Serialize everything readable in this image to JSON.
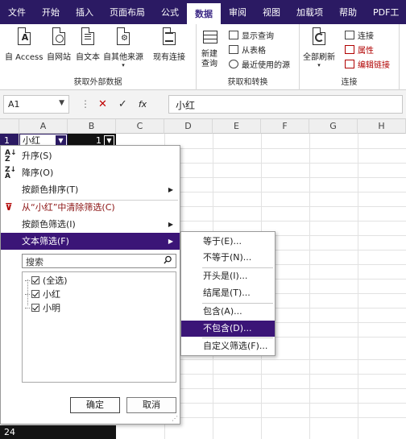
{
  "menu": {
    "tabs": [
      "文件",
      "开始",
      "插入",
      "页面布局",
      "公式",
      "数据",
      "审阅",
      "视图",
      "加载项",
      "帮助",
      "PDF工"
    ],
    "active_tab": "数据"
  },
  "ribbon": {
    "group_external": {
      "label": "获取外部数据",
      "buttons": [
        "自 Access",
        "自网站",
        "自文本",
        "自其他来源",
        "现有连接"
      ]
    },
    "group_transform": {
      "label": "获取和转换",
      "new_query": "新建\n查询",
      "small": [
        "显示查询",
        "从表格",
        "最近使用的源"
      ]
    },
    "group_connections": {
      "label": "连接",
      "refresh_all": "全部刷新",
      "small": [
        "连接",
        "属性",
        "编辑链接"
      ]
    }
  },
  "formula_bar": {
    "name_box": "A1",
    "cancel_glyph": "✕",
    "enter_glyph": "✓",
    "fx_label": "fx",
    "formula_value": "小红"
  },
  "grid": {
    "columns": [
      "A",
      "B",
      "C",
      "D",
      "E",
      "F",
      "G",
      "H"
    ],
    "cell_a1": "小红",
    "cell_b1": "1",
    "row_1": "1",
    "row_24": "24"
  },
  "filter_menu": {
    "sort_asc": "升序(S)",
    "sort_desc": "降序(O)",
    "sort_by_color": "按颜色排序(T)",
    "clear_filter": "从“小红”中清除筛选(C)",
    "filter_by_color": "按颜色筛选(I)",
    "text_filter": "文本筛选(F)",
    "search_placeholder": "搜索",
    "list_items": [
      "(全选)",
      "小红",
      "小明"
    ],
    "ok_button": "确定",
    "cancel_button": "取消"
  },
  "text_filter_submenu": {
    "items": [
      "等于(E)...",
      "不等于(N)...",
      "开头是(I)...",
      "结尾是(T)...",
      "包含(A)...",
      "不包含(D)...",
      "自定义筛选(F)..."
    ],
    "active_index": 5
  },
  "colors": {
    "menubar_bg": "#2b1a63",
    "highlight": "#3b1577",
    "accent_red": "#b00000"
  }
}
